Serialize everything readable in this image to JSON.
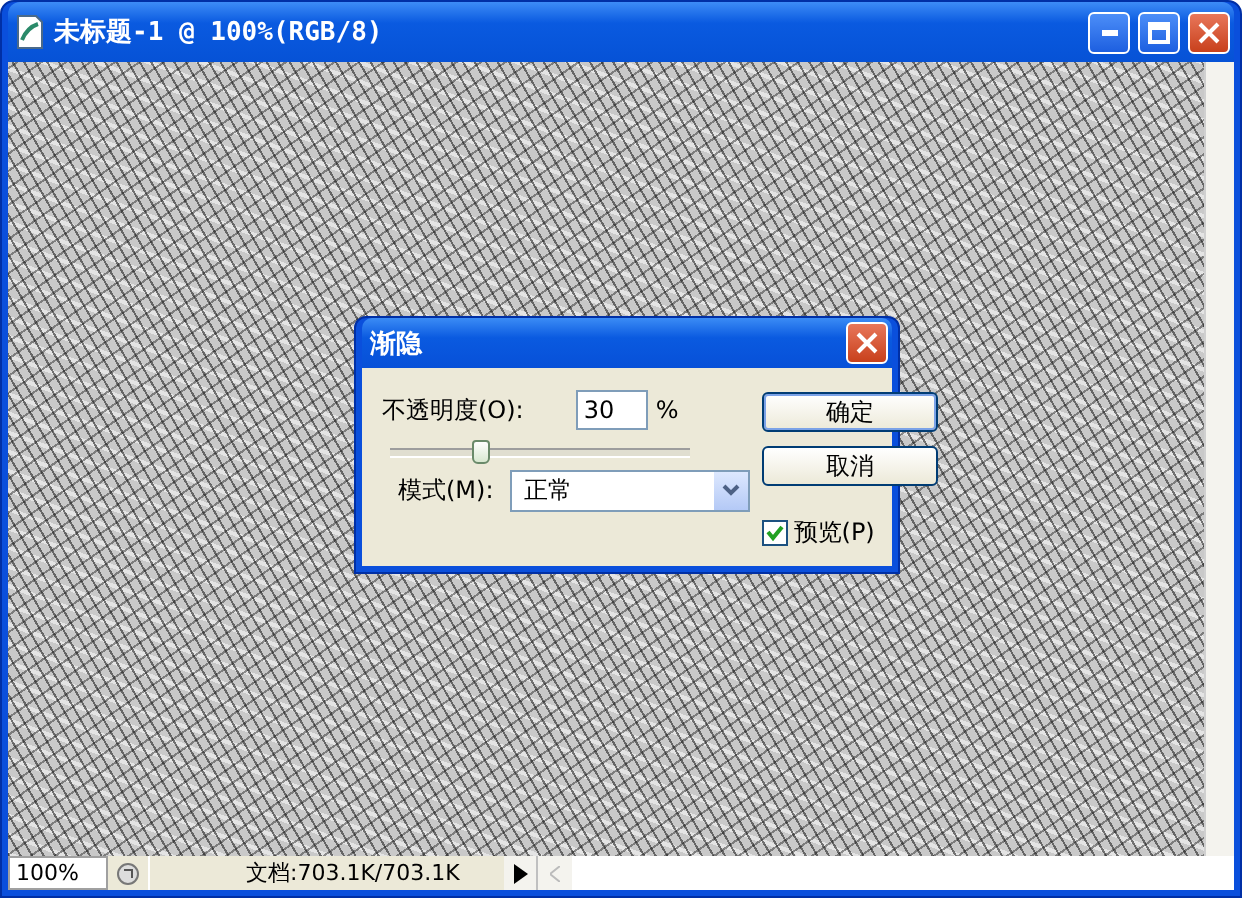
{
  "window": {
    "title": "未标题-1 @ 100%(RGB/8)"
  },
  "dialog": {
    "title": "渐隐",
    "opacity": {
      "label": "不透明度(O):",
      "value": "30",
      "unit": "%",
      "level": 0.3
    },
    "mode": {
      "label": "模式(M):",
      "value": "正常"
    },
    "buttons": [
      {
        "label": "确定",
        "default": true
      },
      {
        "label": "取消",
        "default": false
      }
    ],
    "preview": {
      "label": "预览(P)",
      "checked": true
    }
  },
  "status_bar": {
    "zoom": "100%",
    "doc_info": "文档:703.1K/703.1K"
  }
}
